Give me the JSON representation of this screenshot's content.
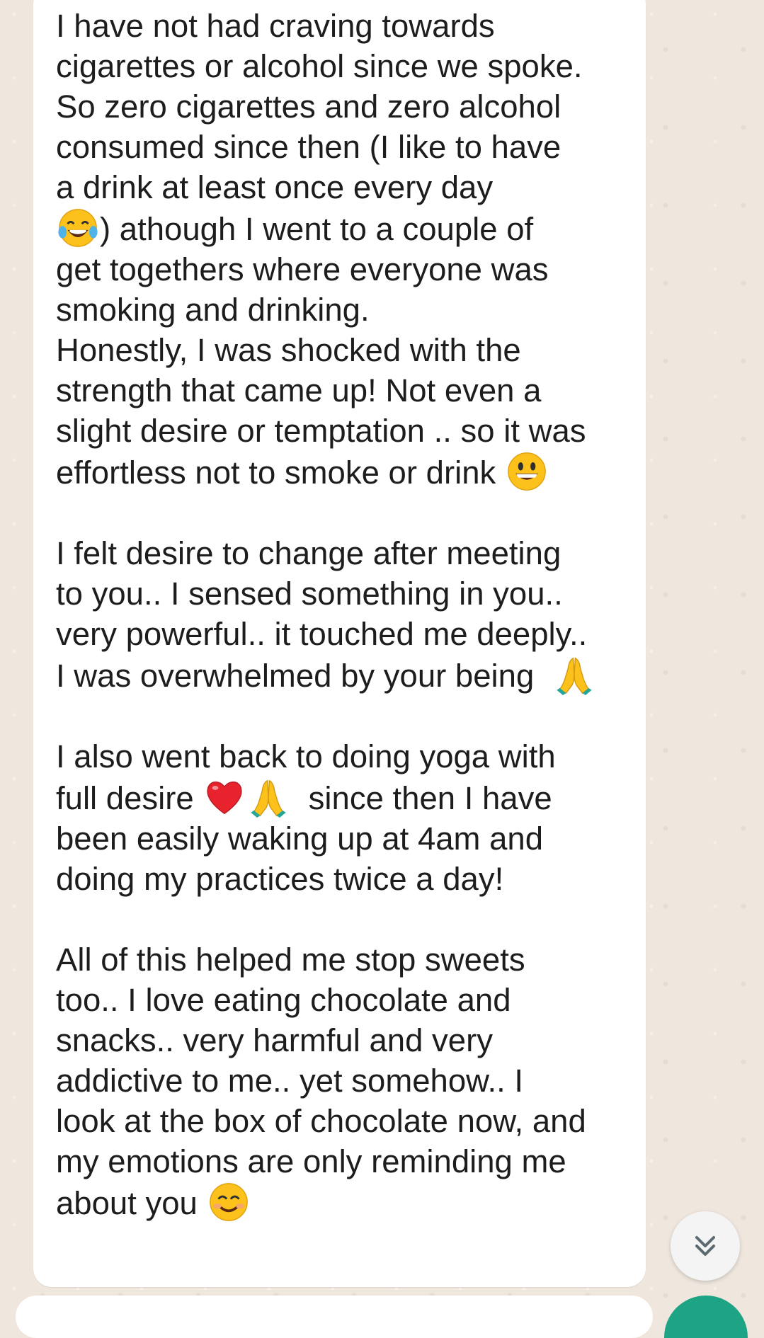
{
  "message": {
    "paragraphs": [
      {
        "segments": [
          {
            "text": "I have not had craving towards\ncigarettes or alcohol since we spoke.\nSo zero cigarettes and zero alcohol\nconsumed since then (I like to have\na drink at least once every day\n"
          },
          {
            "emoji": "tears-of-joy-emoji"
          },
          {
            "text": ") athough I went to a couple of\nget togethers where everyone was\nsmoking and drinking.\nHonestly, I was shocked with the\nstrength that came up! Not even a\nslight desire or temptation .. so it was\neffortless not to smoke or drink "
          },
          {
            "emoji": "grinning-face-emoji"
          }
        ]
      },
      {
        "segments": [
          {
            "text": "I felt desire to change after meeting\nto you.. I sensed something in you..\nvery powerful.. it touched me deeply..\nI was overwhelmed by your being  "
          },
          {
            "emoji": "folded-hands-emoji"
          }
        ]
      },
      {
        "segments": [
          {
            "text": "I also went back to doing yoga with\nfull desire "
          },
          {
            "emoji": "red-heart-emoji"
          },
          {
            "emoji": "folded-hands-emoji"
          },
          {
            "text": "  since then I have\nbeen easily waking up at 4am and\ndoing my practices twice a day!"
          }
        ]
      },
      {
        "segments": [
          {
            "text": "All of this helped me stop sweets\ntoo.. I love eating chocolate and\nsnacks.. very harmful and very\naddictive to me.. yet somehow.. I\nlook at the box of chocolate now, and\nmy emotions are only reminding me\nabout you "
          },
          {
            "emoji": "smiling-face-with-smiling-eyes-emoji"
          }
        ]
      }
    ]
  },
  "colors": {
    "background": "#efe7de",
    "bubble": "#ffffff",
    "text": "#1d1d1d",
    "accent": "#1ea384"
  },
  "controls": {
    "scroll_down_icon": "double-chevron-down-icon"
  }
}
